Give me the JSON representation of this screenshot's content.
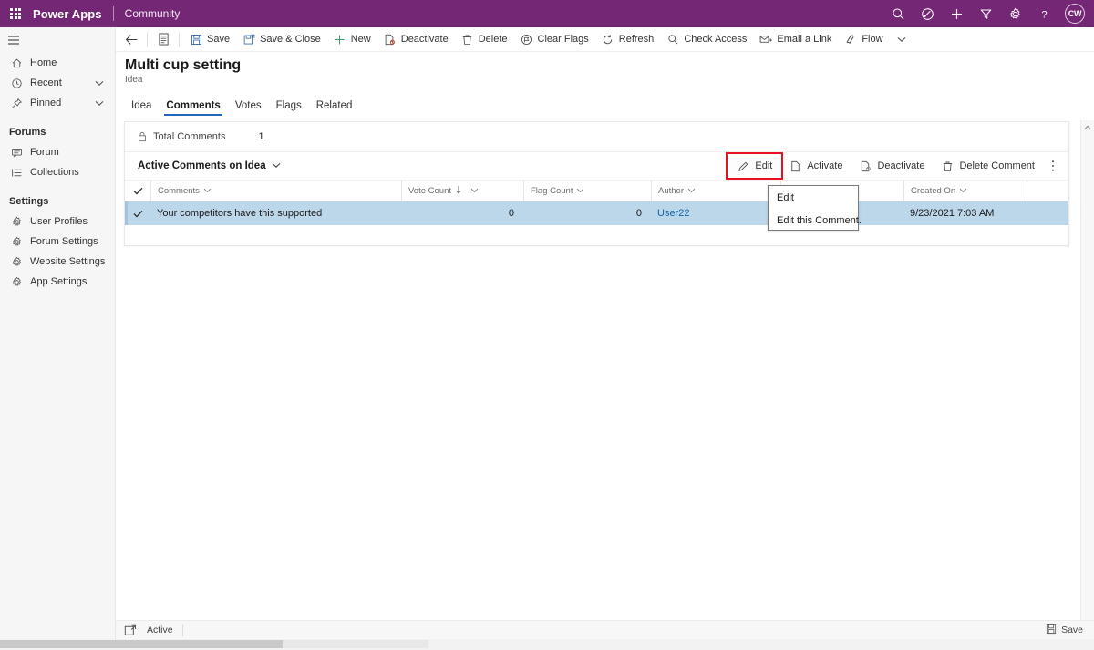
{
  "topbar": {
    "waffle_label": "App launcher",
    "brand": "Power Apps",
    "app_name": "Community",
    "icons": [
      {
        "name": "search-icon",
        "label": "Search"
      },
      {
        "name": "environment-icon",
        "label": "Environment"
      },
      {
        "name": "plus-icon",
        "label": "Quick create"
      },
      {
        "name": "filter-icon",
        "label": "Filter"
      },
      {
        "name": "gear-icon",
        "label": "Settings"
      },
      {
        "name": "help-icon",
        "label": "Help"
      }
    ],
    "avatar_initials": "CW",
    "background_color": "#742774"
  },
  "sidebar": {
    "hamburger_label": "Expand navigation",
    "items": [
      {
        "label": "Home",
        "icon": "home-icon",
        "chevron": false
      },
      {
        "label": "Recent",
        "icon": "clock-icon",
        "chevron": true
      },
      {
        "label": "Pinned",
        "icon": "pin-icon",
        "chevron": true
      }
    ],
    "groups": [
      {
        "title": "Forums",
        "items": [
          {
            "label": "Forum",
            "icon": "comment-icon"
          },
          {
            "label": "Collections",
            "icon": "list-icon"
          }
        ]
      },
      {
        "title": "Settings",
        "items": [
          {
            "label": "User Profiles",
            "icon": "gear-icon"
          },
          {
            "label": "Forum Settings",
            "icon": "gear-icon"
          },
          {
            "label": "Website Settings",
            "icon": "gear-icon"
          },
          {
            "label": "App Settings",
            "icon": "gear-icon"
          }
        ]
      }
    ]
  },
  "commandbar": {
    "back_label": "Back",
    "form_selector_label": "Form selector",
    "buttons": [
      {
        "label": "Save",
        "icon": "save-icon"
      },
      {
        "label": "Save & Close",
        "icon": "save-close-icon"
      },
      {
        "label": "New",
        "icon": "plus-icon"
      },
      {
        "label": "Deactivate",
        "icon": "deactivate-icon"
      },
      {
        "label": "Delete",
        "icon": "trash-icon"
      },
      {
        "label": "Clear Flags",
        "icon": "clear-flags-icon"
      },
      {
        "label": "Refresh",
        "icon": "refresh-icon"
      },
      {
        "label": "Check Access",
        "icon": "check-access-icon"
      },
      {
        "label": "Email a Link",
        "icon": "email-link-icon"
      },
      {
        "label": "Flow",
        "icon": "flow-icon",
        "chevron": true
      }
    ]
  },
  "record": {
    "title": "Multi cup setting",
    "subtitle": "Idea",
    "tabs": [
      {
        "label": "Idea",
        "active": false
      },
      {
        "label": "Comments",
        "active": true
      },
      {
        "label": "Votes",
        "active": false
      },
      {
        "label": "Flags",
        "active": false
      },
      {
        "label": "Related",
        "active": false
      }
    ]
  },
  "subgrid": {
    "total_label": "Total Comments",
    "total_value": "1",
    "total_icon": "lock-icon",
    "view_name": "Active Comments on Idea",
    "commands": [
      {
        "label": "Edit",
        "icon": "pencil-icon",
        "highlighted": true
      },
      {
        "label": "Activate",
        "icon": "activate-icon",
        "highlighted": false
      },
      {
        "label": "Deactivate",
        "icon": "deactivate-icon",
        "highlighted": false
      },
      {
        "label": "Delete Comment",
        "icon": "trash-icon",
        "highlighted": false
      }
    ],
    "overflow_label": "More commands",
    "columns": [
      {
        "label": "Comments",
        "sorted": false
      },
      {
        "label": "Vote Count",
        "sorted": true,
        "sort_dir": "desc"
      },
      {
        "label": "Flag Count",
        "sorted": false
      },
      {
        "label": "Author",
        "sorted": false
      },
      {
        "label": "",
        "sorted": false
      },
      {
        "label": "Created On",
        "sorted": false
      }
    ],
    "rows": [
      {
        "selected": true,
        "comments": "Your competitors have this supported",
        "vote_count": "0",
        "flag_count": "0",
        "author": "User22",
        "blank": "",
        "created_on": "9/23/2021 7:03 AM"
      }
    ],
    "selected_row_color": "#bcd6ea",
    "highlight_color": "#e81123"
  },
  "tooltip": {
    "title": "Edit",
    "description": "Edit this Comment."
  },
  "statusbar": {
    "status_icon": "open-record-icon",
    "status_text": "Active",
    "save_label": "Save",
    "save_icon": "save-icon"
  }
}
